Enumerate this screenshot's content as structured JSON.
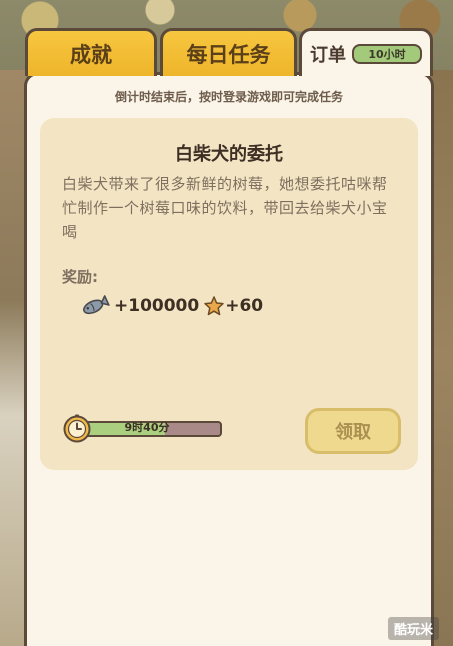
{
  "tabs": {
    "achievement": "成就",
    "daily": "每日任务",
    "order": "订单",
    "order_timer": "10小时"
  },
  "notice": "倒计时结束后，按时登录游戏即可完成任务",
  "task": {
    "title": "白柴犬的委托",
    "description": "白柴犬带来了很多新鲜的树莓，她想委托咕咪帮忙制作一个树莓口味的饮料，带回去给柴犬小宝喝",
    "reward_label": "奖励:",
    "reward_fish": "+100000",
    "reward_star": "+60",
    "time_left": "9时40分",
    "time_progress": 0.62,
    "claim_label": "领取"
  },
  "watermark": "酷玩米",
  "colors": {
    "tab_yellow": "#eeb52a",
    "panel": "#fbf4e8",
    "card": "#f3e5c3",
    "progress_fill": "#a9cf7f",
    "button_disabled": "#efd98f"
  }
}
